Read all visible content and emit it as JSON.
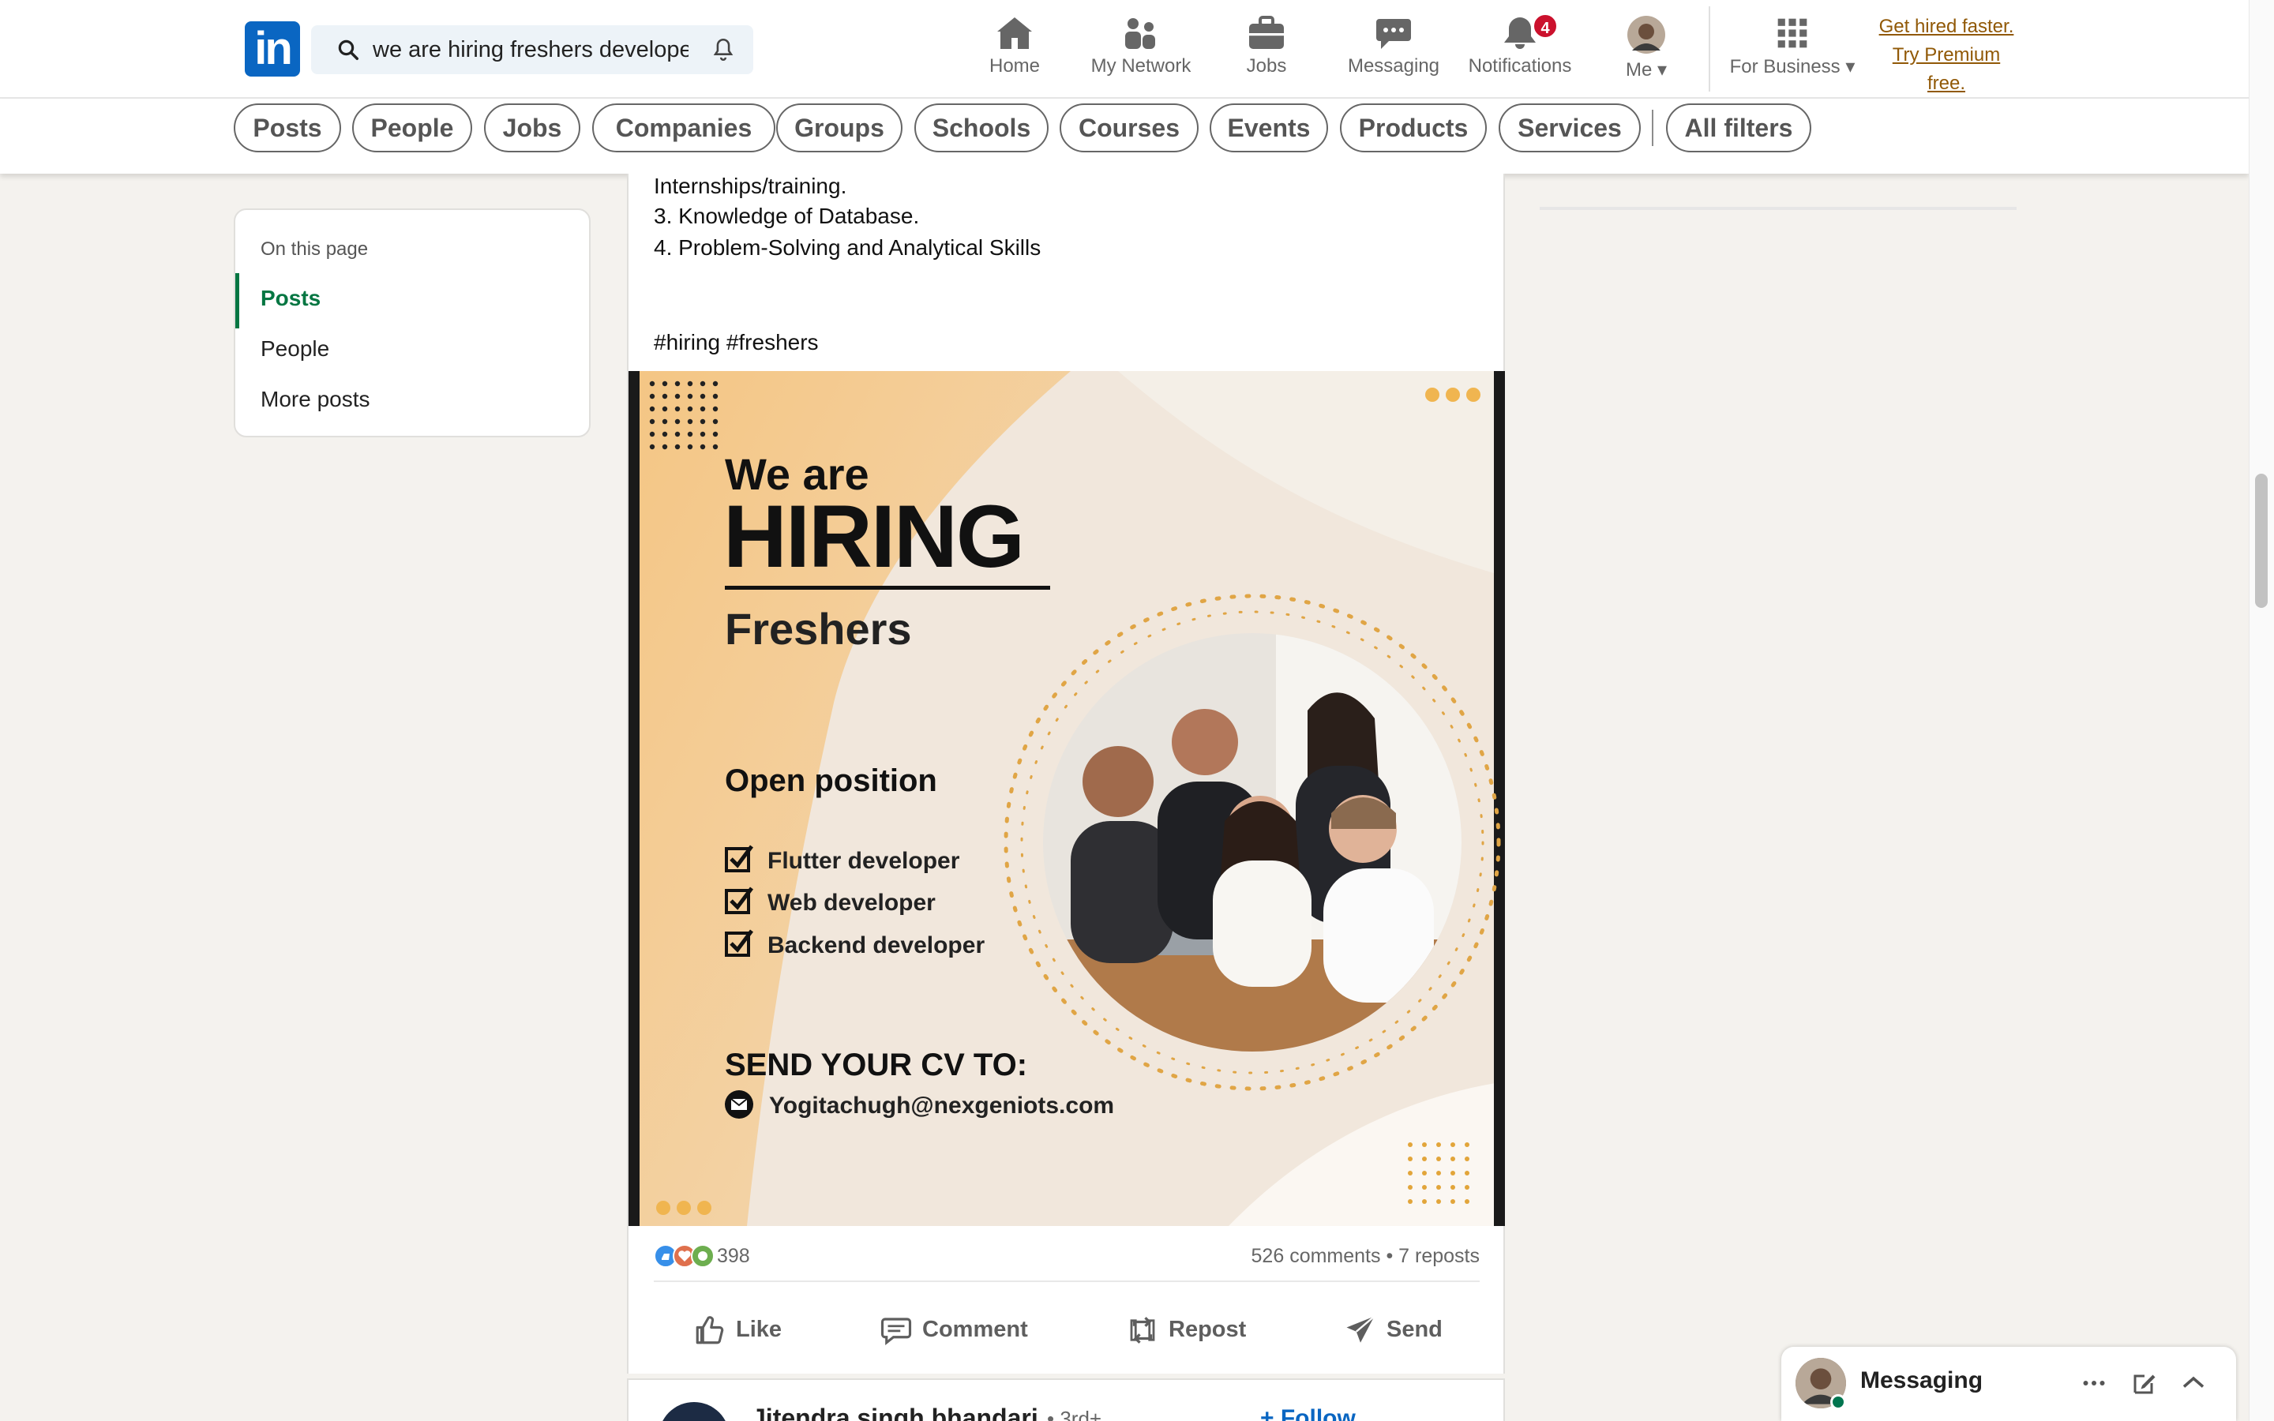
{
  "header": {
    "logo_text": "in",
    "search_value": "we are hiring freshers developer",
    "nav": [
      {
        "label": "Home",
        "icon": "home-icon"
      },
      {
        "label": "My Network",
        "icon": "my-network-icon"
      },
      {
        "label": "Jobs",
        "icon": "jobs-icon"
      },
      {
        "label": "Messaging",
        "icon": "messaging-icon"
      },
      {
        "label": "Notifications",
        "icon": "notifications-icon",
        "badge": "4"
      },
      {
        "label": "Me",
        "icon": "avatar"
      },
      {
        "label": "For Business",
        "icon": "grid-icon"
      }
    ],
    "premium_lines": [
      "Get hired faster.",
      "Try Premium",
      "free."
    ]
  },
  "filters": [
    "Posts",
    "People",
    "Jobs",
    "Companies",
    "Groups",
    "Schools",
    "Courses",
    "Events",
    "Products",
    "Services",
    "All filters"
  ],
  "on_this_page": {
    "title": "On this page",
    "items": [
      "Posts",
      "People",
      "More posts"
    ],
    "active": "Posts"
  },
  "post": {
    "text_lines": [
      "Internships/training.",
      " 3. Knowledge of Database.",
      " 4. Problem-Solving and Analytical Skills",
      "#hiring #freshers"
    ],
    "image": {
      "we_are": "We are",
      "hiring": "HIRING",
      "freshers": "Freshers",
      "open_position": "Open position",
      "positions": [
        "Flutter developer",
        "Web developer",
        "Backend developer"
      ],
      "send_cv": "SEND YOUR CV TO:",
      "email": "Yogitachugh@nexgeniots.com"
    },
    "reactions_count": "398",
    "comments": "526 comments",
    "reposts": "7 reposts",
    "actions": [
      "Like",
      "Comment",
      "Repost",
      "Send"
    ]
  },
  "next_post": {
    "author": "Jitendra singh bhandari",
    "degree": "• 3rd+",
    "follow": "+ Follow"
  },
  "messaging": {
    "title": "Messaging"
  },
  "colors": {
    "brand": "#0a66c2",
    "active_green": "#057642",
    "premium": "#915907",
    "badge": "#cb112d"
  }
}
